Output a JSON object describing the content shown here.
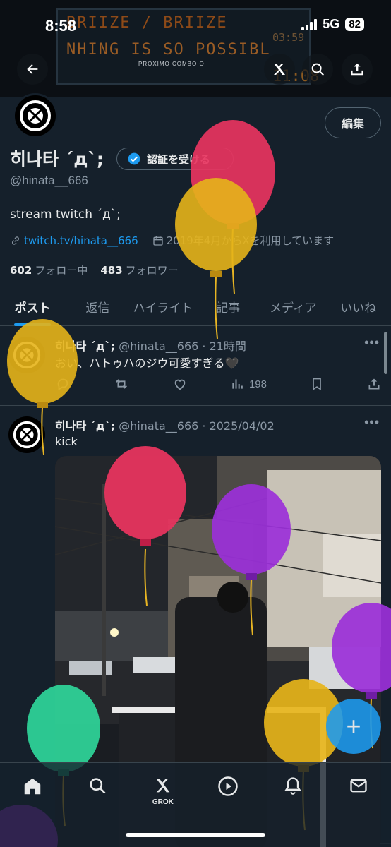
{
  "status_bar": {
    "time": "8:58",
    "network": "5G",
    "battery": "82"
  },
  "banner": {
    "led_line_1": "BRIIZE / BRIIZE",
    "led_line_2": "NHING IS SO POSSIBL",
    "led_time_1": "03:59",
    "led_time_2": "11:08",
    "small_text": "PRÓXIMO COMBOIO"
  },
  "header_actions": {
    "back_icon": "arrow-left-icon",
    "grok_icon": "grok-icon",
    "search_icon": "search-icon",
    "share_icon": "share-icon"
  },
  "profile": {
    "display_name": "히나타 ´д`;",
    "handle": "@hinata__666",
    "edit_label": "編集",
    "verify_label": "認証を受ける",
    "bio": "stream twitch ´д`;",
    "link": "twitch.tv/hinata__666",
    "joined": "2019年4月からXを利用しています",
    "following_count": "602",
    "following_label": "フォロー中",
    "followers_count": "483",
    "followers_label": "フォロワー"
  },
  "tabs": [
    {
      "label": "ポスト",
      "active": true
    },
    {
      "label": "返信"
    },
    {
      "label": "ハイライト"
    },
    {
      "label": "記事"
    },
    {
      "label": "メディア"
    },
    {
      "label": "いいね"
    }
  ],
  "posts": [
    {
      "name": "히나타 ´д`;",
      "handle_time": "@hinata__666 · 21時間",
      "text": "おい、ハトゥハのジウ可愛すぎる🖤",
      "views": "198"
    },
    {
      "name": "히나타 ´д`;",
      "handle_time": "@hinata__666 · 2025/04/02",
      "text": "kick"
    }
  ],
  "bottom_nav": {
    "grok_label": "GROK"
  },
  "fab_label": "+",
  "colors": {
    "accent": "#1d9bf0",
    "background": "#15202b",
    "secondary_text": "#8b98a5"
  }
}
